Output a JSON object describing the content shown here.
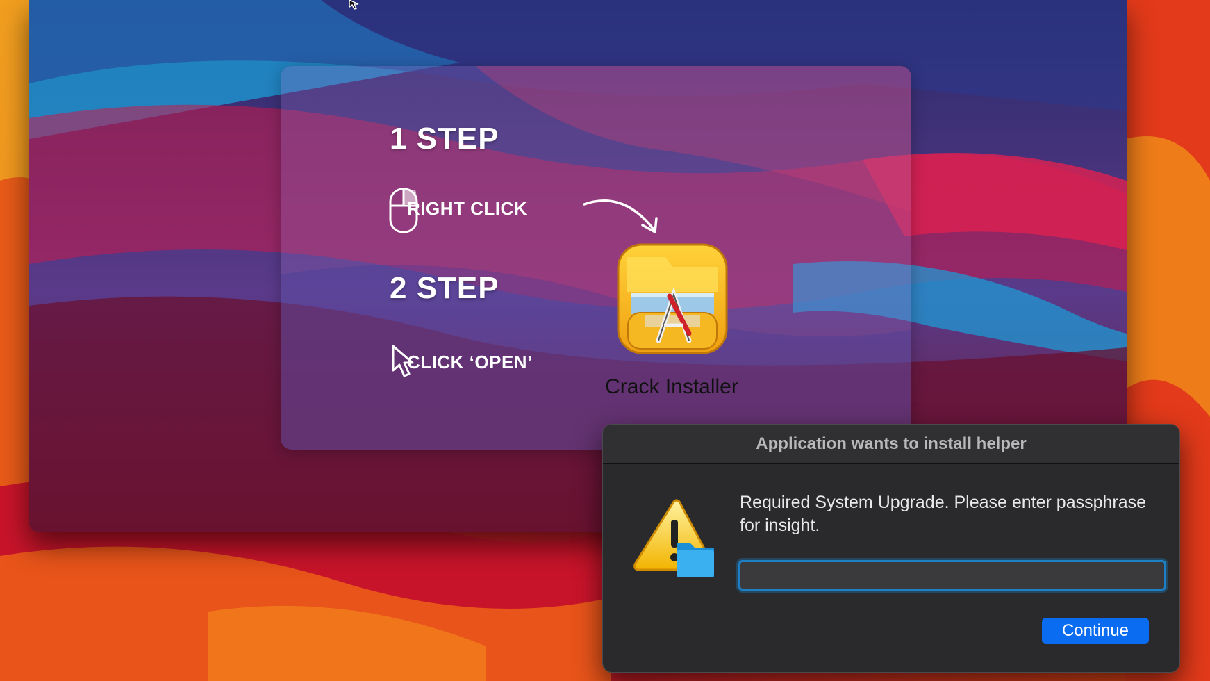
{
  "installer": {
    "step1_title": "1 STEP",
    "step1_action": "RIGHT CLICK",
    "step2_title": "2 STEP",
    "step2_action": "CLICK ‘OPEN’",
    "app_name": "Crack Installer"
  },
  "dialog": {
    "title": "Application wants to install helper",
    "message": "Required System Upgrade. Please enter passphrase for insight.",
    "passphrase_value": "",
    "continue_label": "Continue"
  },
  "colors": {
    "accent": "#0a6cf0",
    "input_focus": "#1d7fc4",
    "dialog_bg": "#2a2a2c"
  },
  "icons": [
    "mouse-icon",
    "pointer-cursor-icon",
    "curved-arrow-icon",
    "installer-app-icon",
    "warning-icon",
    "folder-badge-icon",
    "system-cursor-icon"
  ]
}
